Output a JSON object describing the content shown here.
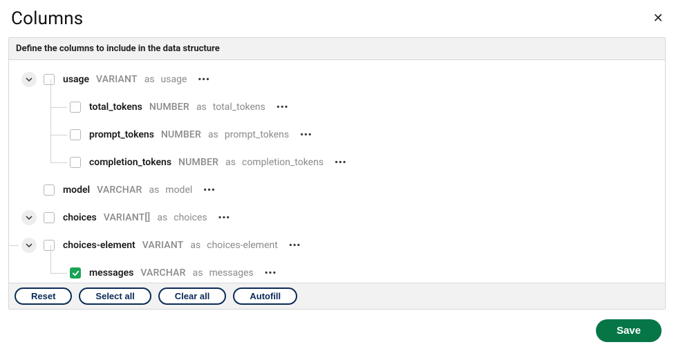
{
  "dialog": {
    "title": "Columns",
    "close_glyph": "✕"
  },
  "panel": {
    "header": "Define the columns to include in the data structure",
    "as_word": "as"
  },
  "tree": {
    "usage": {
      "name": "usage",
      "type": "VARIANT",
      "alias": "usage",
      "checked": false,
      "expandable": true,
      "children": {
        "total_tokens": {
          "name": "total_tokens",
          "type": "NUMBER",
          "alias": "total_tokens",
          "checked": false,
          "expandable": false
        },
        "prompt_tokens": {
          "name": "prompt_tokens",
          "type": "NUMBER",
          "alias": "prompt_tokens",
          "checked": false,
          "expandable": false
        },
        "completion_tokens": {
          "name": "completion_tokens",
          "type": "NUMBER",
          "alias": "completion_tokens",
          "checked": false,
          "expandable": false
        }
      }
    },
    "model": {
      "name": "model",
      "type": "VARCHAR",
      "alias": "model",
      "checked": false,
      "expandable": false
    },
    "choices": {
      "name": "choices",
      "type": "VARIANT[]",
      "alias": "choices",
      "checked": false,
      "expandable": true,
      "children": {
        "choices_element": {
          "name": "choices-element",
          "type": "VARIANT",
          "alias": "choices-element",
          "checked": false,
          "expandable": true,
          "children": {
            "messages": {
              "name": "messages",
              "type": "VARCHAR",
              "alias": "messages",
              "checked": true,
              "expandable": false
            }
          }
        }
      }
    }
  },
  "actions": {
    "reset": "Reset",
    "select_all": "Select all",
    "clear_all": "Clear all",
    "autofill": "Autofill"
  },
  "footer": {
    "save": "Save"
  }
}
